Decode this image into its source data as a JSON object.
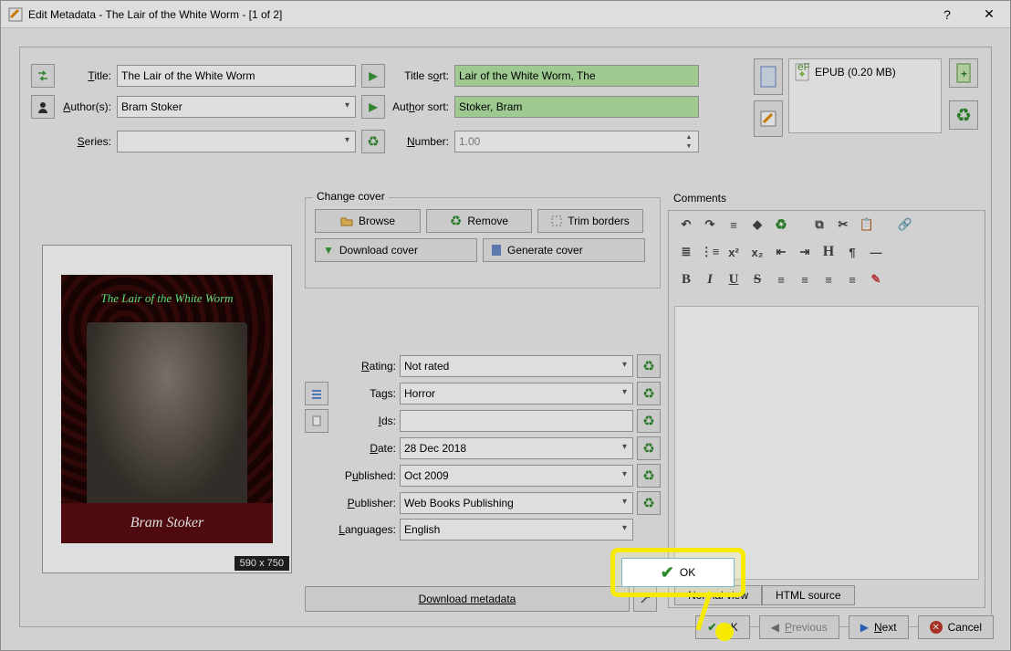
{
  "window": {
    "title": "Edit Metadata - The Lair of the White Worm -  [1 of 2]"
  },
  "fields": {
    "title_label": "Title:",
    "title_value": "The Lair of the White Worm",
    "title_sort_label": "Title sort:",
    "title_sort_value": "Lair of the White Worm, The",
    "authors_label": "Author(s):",
    "authors_value": "Bram Stoker",
    "author_sort_label": "Author sort:",
    "author_sort_value": "Stoker, Bram",
    "series_label": "Series:",
    "series_value": "",
    "number_label": "Number:",
    "number_value": "1.00"
  },
  "cover_group": {
    "legend": "Change cover",
    "browse": "Browse",
    "remove": "Remove",
    "trim": "Trim borders",
    "download": "Download cover",
    "generate": "Generate cover"
  },
  "cover": {
    "title_text": "The Lair of the White Worm",
    "author_text": "Bram Stoker",
    "dimensions": "590 x 750"
  },
  "meta": {
    "rating_label": "Rating:",
    "rating_value": "Not rated",
    "tags_label": "Tags:",
    "tags_value": "Horror",
    "ids_label": "Ids:",
    "ids_value": "",
    "date_label": "Date:",
    "date_value": "28 Dec 2018",
    "published_label": "Published:",
    "published_value": "Oct 2009",
    "publisher_label": "Publisher:",
    "publisher_value": "Web Books Publishing",
    "languages_label": "Languages:",
    "languages_value": "English"
  },
  "download_metadata": "Download metadata",
  "comments": {
    "legend": "Comments",
    "normal_view": "Normal view",
    "html_source": "HTML source"
  },
  "formats": {
    "item": "EPUB (0.20 MB)"
  },
  "footer": {
    "ok": "OK",
    "previous": "Previous",
    "next": "Next",
    "cancel": "Cancel"
  },
  "big_ok": "OK"
}
